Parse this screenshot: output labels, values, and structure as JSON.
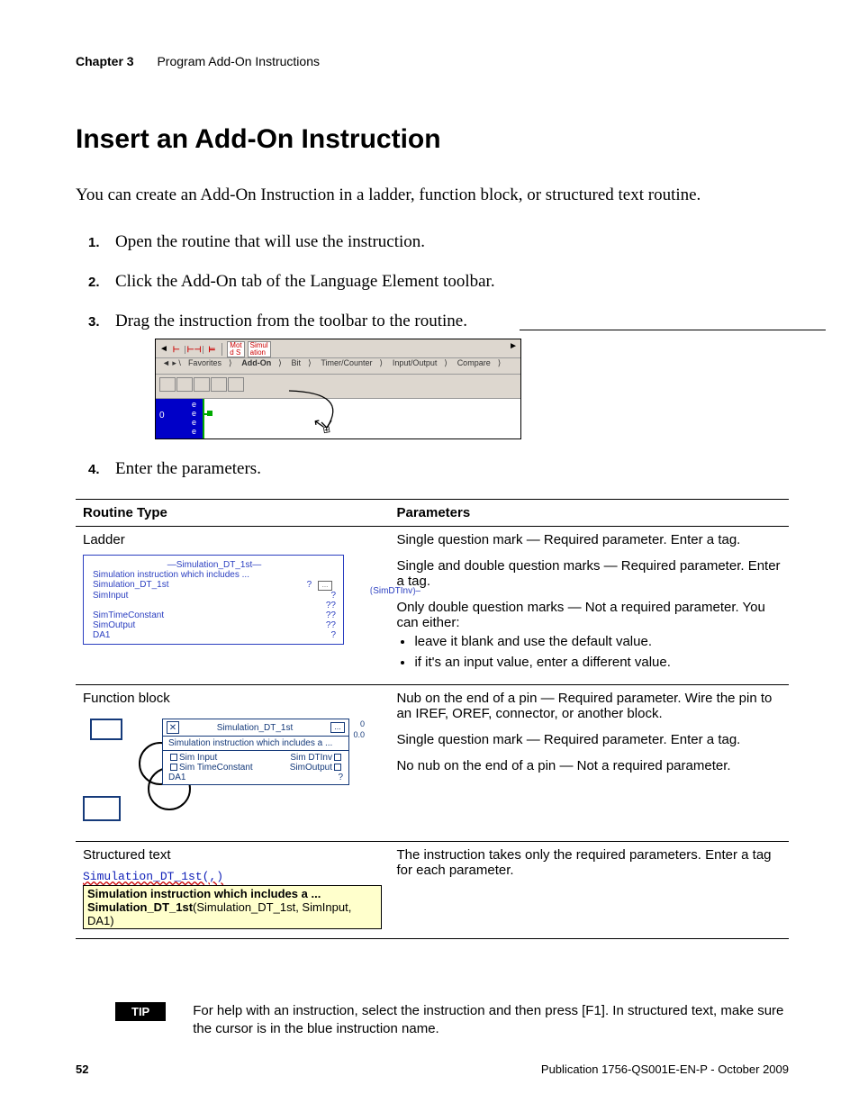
{
  "header": {
    "chapter": "Chapter 3",
    "title": "Program Add-On Instructions"
  },
  "h1": "Insert an Add-On Instruction",
  "intro": "You can create an Add-On Instruction in a ladder, function block, or structured text routine.",
  "steps": {
    "s1": {
      "n": "1.",
      "t": "Open the routine that will use the instruction."
    },
    "s2": {
      "n": "2.",
      "t": "Click the Add-On tab of the Language Element toolbar."
    },
    "s3": {
      "n": "3.",
      "t": "Drag the instruction from the toolbar to the routine."
    },
    "s4": {
      "n": "4.",
      "t": "Enter the parameters."
    }
  },
  "toolbar": {
    "icons": [
      "Mot",
      "Simul",
      "ation"
    ],
    "tabs": {
      "fav": "Favorites",
      "addon": "Add-On",
      "bit": "Bit",
      "tc": "Timer/Counter",
      "io": "Input/Output",
      "cmp": "Compare"
    },
    "rung": "0"
  },
  "table": {
    "h1": "Routine Type",
    "h2": "Parameters",
    "ladder": {
      "label": "Ladder",
      "title": "Simulation_DT_1st",
      "desc": "Simulation instruction which includes ...",
      "p": {
        "a": "Simulation_DT_1st",
        "b": "SimInput",
        "c": "",
        "d": "SimTimeConstant",
        "e": "SimOutput",
        "f": "DA1"
      },
      "q": {
        "a": "?",
        "b": "?",
        "c": "??",
        "d": "??",
        "e": "??",
        "f": "?"
      },
      "out": "SimDTInv",
      "params": {
        "p1": "Single question mark — Required parameter. Enter a tag.",
        "p2": "Single and double question marks — Required parameter. Enter a tag.",
        "p3": "Only double question marks — Not a required parameter. You can either:",
        "b1": "leave it blank and use the default value.",
        "b2": "if it's an input value, enter a different value."
      }
    },
    "fb": {
      "label": "Function block",
      "name": "Simulation_DT_1st",
      "desc": "Simulation instruction which includes a ...",
      "pins": {
        "in1": "Sim Input",
        "in2": "Sim TimeConstant",
        "in3": "DA1",
        "out1": "Sim DTInv",
        "out2": "SimOutput"
      },
      "v0": "0",
      "v00": "0.0",
      "q": "?",
      "params": {
        "p1": "Nub on the end of a pin — Required parameter. Wire the pin to an IREF, OREF, connector, or another block.",
        "p2": "Single question mark — Required parameter. Enter a tag.",
        "p3": "No nub on the end of a pin — Not a required parameter."
      }
    },
    "st": {
      "label": "Structured text",
      "code": "Simulation_DT_1st(,)",
      "tip1": "Simulation instruction which includes a ...",
      "tip2a": "Simulation_DT_1st",
      "tip2b": "(Simulation_DT_1st, SimInput, DA1)",
      "params": {
        "p1": "The instruction takes only the required parameters. Enter a tag for each parameter."
      }
    }
  },
  "tip": {
    "badge": "TIP",
    "text": "For help with an instruction, select the instruction and then press [F1]. In structured text, make sure the cursor is in the blue instruction name."
  },
  "footer": {
    "page": "52",
    "pub": "Publication 1756-QS001E-EN-P - October 2009"
  }
}
